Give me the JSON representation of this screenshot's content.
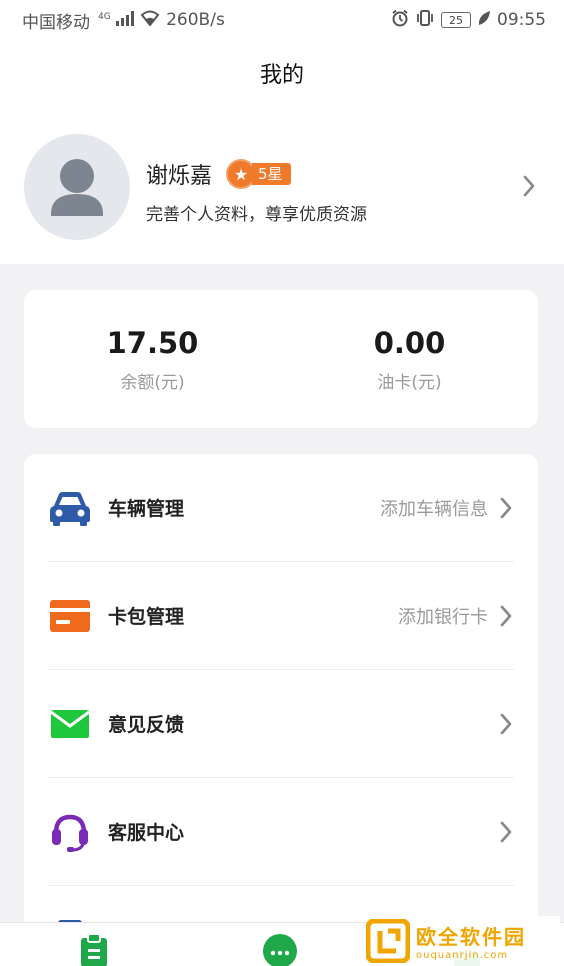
{
  "status_bar": {
    "carrier": "中国移动",
    "network_type": "4G",
    "speed": "260B/s",
    "battery": "25",
    "time": "09:55"
  },
  "header": {
    "title": "我的"
  },
  "profile": {
    "name": "谢烁嘉",
    "rank": "5星",
    "hint": "完善个人资料，尊享优质资源"
  },
  "balances": [
    {
      "value": "17.50",
      "label": "余额(元)"
    },
    {
      "value": "0.00",
      "label": "油卡(元)"
    }
  ],
  "menu": [
    {
      "label": "车辆管理",
      "hint": "添加车辆信息",
      "icon": "car-icon",
      "color": "#2f5aa8"
    },
    {
      "label": "卡包管理",
      "hint": "添加银行卡",
      "icon": "card-icon",
      "color": "#f06a1e"
    },
    {
      "label": "意见反馈",
      "hint": "",
      "icon": "envelope-icon",
      "color": "#1fc73c"
    },
    {
      "label": "客服中心",
      "hint": "",
      "icon": "headset-icon",
      "color": "#7a2bb5"
    }
  ],
  "tabbar": {
    "icons": [
      "clipboard-icon",
      "chat-icon",
      "heart-icon"
    ],
    "accent": "#1fa84a"
  },
  "watermark": {
    "title": "欧全软件园",
    "url": "ouquanrjin.com"
  }
}
